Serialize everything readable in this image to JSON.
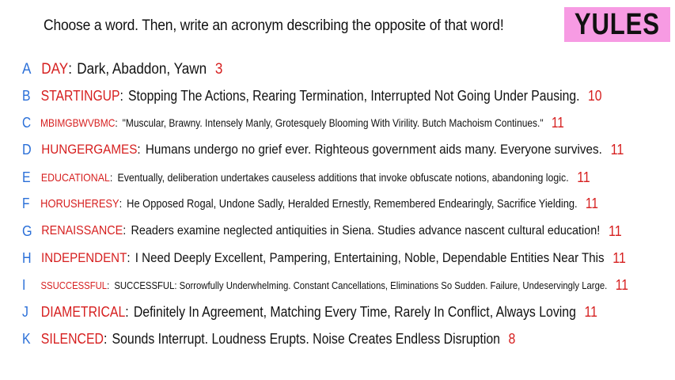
{
  "header": {
    "prompt": "Choose a word. Then, write an acronym describing the opposite of that word!",
    "team": "YULES",
    "team_color": "#f79be3"
  },
  "colors": {
    "letter": "#2a6fd8",
    "word": "#d61f1f",
    "score": "#d61f1f",
    "text": "#111111"
  },
  "entries": [
    {
      "letter": "A",
      "word": "DAY",
      "definition": "Dark, Abaddon, Yawn",
      "score": "3"
    },
    {
      "letter": "B",
      "word": "STARTINGUP",
      "definition": "Stopping The Actions, Rearing Termination, Interrupted Not Going Under Pausing.",
      "score": "10"
    },
    {
      "letter": "C",
      "word": "MBIMGBWVBMC",
      "definition": "\"Muscular, Brawny. Intensely Manly, Grotesquely Blooming With Virility. Butch Machoism Continues.\"",
      "score": "11"
    },
    {
      "letter": "D",
      "word": "HUNGERGAMES",
      "definition": "Humans undergo no grief ever. Righteous government aids many. Everyone survives.",
      "score": "11"
    },
    {
      "letter": "E",
      "word": "EDUCATIONAL",
      "definition": "Eventually, deliberation undertakes causeless additions that invoke obfuscate notions, abandoning logic.",
      "score": "11"
    },
    {
      "letter": "F",
      "word": "HORUSHERESY",
      "definition": "He Opposed Rogal, Undone Sadly, Heralded Ernestly, Remembered Endearingly, Sacrifice Yielding.",
      "score": "11"
    },
    {
      "letter": "G",
      "word": "RENAISSANCE",
      "definition": "Readers examine neglected antiquities in Siena. Studies advance nascent cultural education!",
      "score": "11"
    },
    {
      "letter": "H",
      "word": "INDEPENDENT",
      "definition": "I Need Deeply Excellent, Pampering, Entertaining, Noble, Dependable Entities Near This",
      "score": "11"
    },
    {
      "letter": "I",
      "word": "SSUCCESSFUL",
      "definition": "SUCCESSFUL: Sorrowfully Underwhelming. Constant Cancellations, Eliminations So Sudden. Failure, Undeservingly Large.",
      "score": "11"
    },
    {
      "letter": "J",
      "word": "DIAMETRICAL",
      "definition": "Definitely In Agreement, Matching Every Time, Rarely In Conflict, Always Loving",
      "score": "11"
    },
    {
      "letter": "K",
      "word": "SILENCED",
      "definition": "Sounds Interrupt. Loudness Erupts. Noise Creates Endless Disruption",
      "score": "8"
    }
  ]
}
